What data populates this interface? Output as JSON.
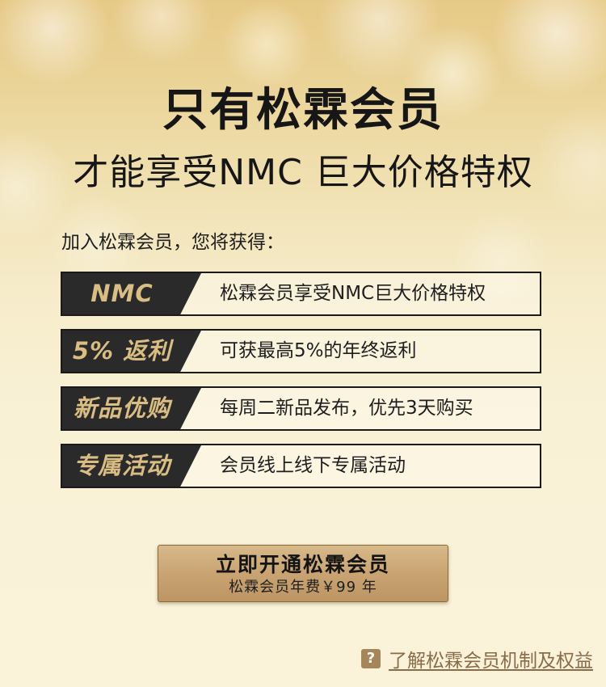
{
  "header": {
    "title": "只有松霖会员",
    "subtitle": "才能享受NMC 巨大价格特权"
  },
  "intro": {
    "text": "加入松霖会员，您将获得："
  },
  "benefits": [
    {
      "tag": "NMC",
      "description": "松霖会员享受NMC巨大价格特权"
    },
    {
      "tag": "5% 返利",
      "description": "可获最高5%的年终返利"
    },
    {
      "tag": "新品优购",
      "description": "每周二新品发布，优先3天购买"
    },
    {
      "tag": "专属活动",
      "description": "会员线上线下专属活动"
    }
  ],
  "cta": {
    "title": "立即开通松霖会员",
    "price": "松霖会员年费￥99 年"
  },
  "help": {
    "icon": "?",
    "text": "了解松霖会员机制及权益"
  },
  "colors": {
    "tag_background": "#2a2a2a",
    "tag_text": "#d9bd83",
    "button_gold": "#c9a472",
    "link_brown": "#8a6c48"
  }
}
